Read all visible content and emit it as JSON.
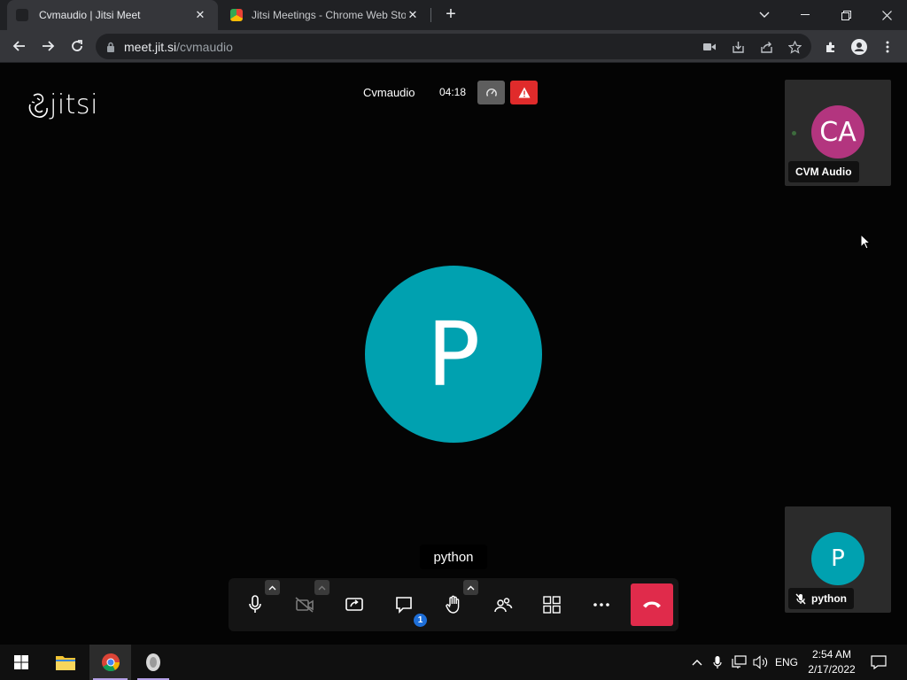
{
  "browser": {
    "tabs": [
      {
        "title": "Cvmaudio | Jitsi Meet",
        "active": true
      },
      {
        "title": "Jitsi Meetings - Chrome Web Sto",
        "active": false
      }
    ],
    "url_host": "meet.jit.si",
    "url_path": "/cvmaudio"
  },
  "meeting": {
    "logo_text": "jitsi",
    "subject": "Cvmaudio",
    "timer": "04:18",
    "dominant_speaker": {
      "initial": "P",
      "name": "python",
      "color": "#00a1b0"
    },
    "participants": [
      {
        "initials": "CA",
        "name": "CVM Audio",
        "color": "#b3357f",
        "muted": false
      },
      {
        "initials": "P",
        "name": "python",
        "color": "#00a1b0",
        "muted": true
      }
    ],
    "toolbar": {
      "unread_chat_count": "1",
      "hangup_color": "#e02b4b"
    }
  },
  "taskbar": {
    "language": "ENG",
    "time": "2:54 AM",
    "date": "2/17/2022"
  }
}
